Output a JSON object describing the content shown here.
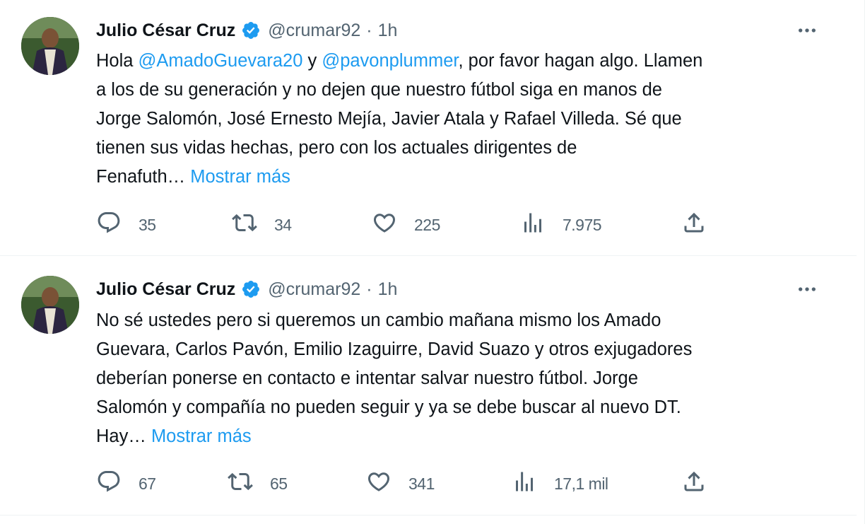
{
  "tweets": [
    {
      "author_name": "Julio César Cruz",
      "handle": "@crumar92",
      "dot": "·",
      "time": "1h",
      "text_before_m1": "Hola ",
      "mention1": "@AmadoGuevara20",
      "text_between": " y ",
      "mention2": "@pavonplummer",
      "text_after": ", por favor hagan algo. Llamen\na los de su generación y no dejen que nuestro fútbol siga en manos de\nJorge Salomón, José Ernesto Mejía, Javier Atala y Rafael Villeda. Sé que\ntienen sus vidas hechas, pero con los actuales dirigentes de\nFenafuth… ",
      "show_more": "Mostrar más",
      "replies": "35",
      "retweets": "34",
      "likes": "225",
      "views": "7.975"
    },
    {
      "author_name": "Julio César Cruz",
      "handle": "@crumar92",
      "dot": "·",
      "time": "1h",
      "text": "No sé ustedes pero si queremos un cambio mañana mismo los Amado\nGuevara, Carlos Pavón, Emilio Izaguirre, David Suazo y otros exjugadores\ndeberían ponerse en contacto e intentar salvar nuestro fútbol. Jorge\nSalomón y compañía no pueden seguir y ya se debe buscar al nuevo DT.\nHay… ",
      "show_more": "Mostrar más",
      "replies": "67",
      "retweets": "65",
      "likes": "341",
      "views": "17,1 mil"
    }
  ],
  "icons": {
    "more": "more-dots-icon",
    "verified": "verified-badge-icon",
    "reply": "reply-icon",
    "retweet": "retweet-icon",
    "like": "heart-icon",
    "views": "views-icon",
    "share": "share-icon"
  },
  "colors": {
    "link": "#1d9bf0",
    "secondary_text": "#536471",
    "primary_text": "#0f1419",
    "verified": "#1d9bf0"
  }
}
